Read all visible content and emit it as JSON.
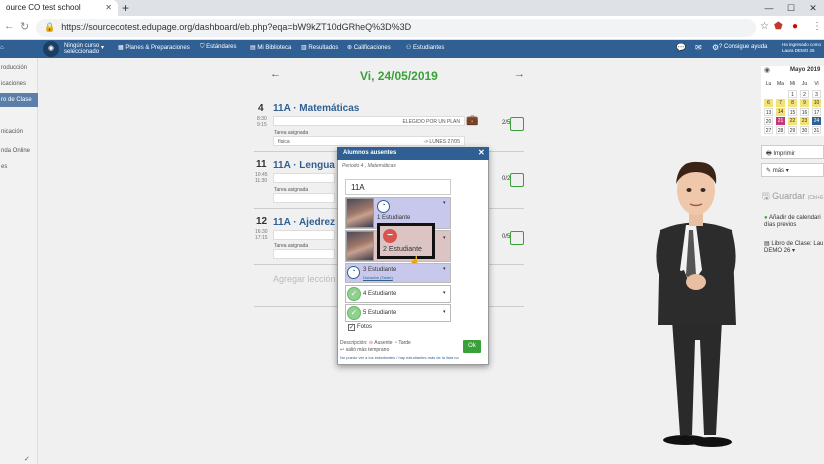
{
  "browser": {
    "tab_title": "ource CO test school",
    "url": "https://sourcecotest.edupage.org/dashboard/eb.php?eqa=bW9kZT10dGRheQ%3D%3D"
  },
  "appbar": {
    "period_label_1": "Ningún curso",
    "period_label_2": "seleccionado",
    "menu": [
      "Planes & Preparaciones",
      "Estándares",
      "Mi Biblioteca",
      "Resultados",
      "Calificaciones",
      "Estudiantes"
    ],
    "help": "Consigue ayuda",
    "login_line1": "Ha ingresado como",
    "login_line2": "Laura DEMO 26"
  },
  "sidebar": {
    "items": [
      "roducción",
      "icaciones",
      "ro de Clase",
      "",
      "nicación",
      "",
      "nda Online",
      "es"
    ]
  },
  "day": {
    "title": "Vi, 24/05/2019"
  },
  "lessons": [
    {
      "num": "4",
      "time_start": "8:30",
      "time_end": "9:15",
      "title": "11A · Matemáticas",
      "plan": "ELEGIDO POR UN PLAN",
      "task_label": "Tarea asignada",
      "task": "física",
      "task_due": "-> LUNES 27/05",
      "count": "2/5"
    },
    {
      "num": "11",
      "time_start": "10:45",
      "time_end": "11:30",
      "title": "11A · Lengua Ca",
      "task_label": "Tarea asignada",
      "count": "0/2"
    },
    {
      "num": "12",
      "time_start": "16:30",
      "time_end": "17:15",
      "title": "11A · Ajedrez · E",
      "task_label": "Tarea asignada",
      "count": "0/5"
    }
  ],
  "add_lesson": "Agregar lección",
  "calendar": {
    "month": "Mayo 2019",
    "weekdays": [
      "Lu",
      "Ma",
      "Mi",
      "Ju",
      "Vi"
    ],
    "rows": [
      [
        "",
        "",
        "1",
        "2",
        "3"
      ],
      [
        "6",
        "7",
        "8",
        "9",
        "10"
      ],
      [
        "13",
        "14",
        "15",
        "16",
        "17"
      ],
      [
        "20",
        "21",
        "22",
        "23",
        "24"
      ],
      [
        "27",
        "28",
        "29",
        "30",
        "31"
      ]
    ]
  },
  "right_panel": {
    "print": "Imprimir",
    "more": "más",
    "save": "Guardar",
    "save_suffix": "(Ctrl+E",
    "add_cal_1": "Añadir de calendari",
    "add_cal_2": "días previos",
    "book_1": "Libro de Clase: Lau",
    "book_2": "DEMO 26 ▾"
  },
  "dialog": {
    "title": "Alumnos ausentes",
    "subtitle": "Periodo 4 , Matemáticas",
    "class": "11A",
    "students": [
      {
        "name": "1 Estudiante"
      },
      {
        "name": "2 Estudiante"
      },
      {
        "name": "3 Estudiante",
        "note": "Duración (Tarde)"
      },
      {
        "name": "4 Estudiante"
      },
      {
        "name": "5 Estudiante"
      }
    ],
    "photos_label": "Fotos",
    "desc_label": "Descripción:",
    "desc_absent": "Ausente",
    "desc_late": "Tarde",
    "desc_left": "salió más temprano",
    "footer_note": "No puedo ver a los estudiantes / hay estudiantes más de la lista no",
    "ok": "Ok",
    "popup_label": "2 Estudiante"
  },
  "colors": {
    "brand": "#2f5f93",
    "accent_green": "#3aa13a",
    "absent_red": "#d9534f"
  }
}
